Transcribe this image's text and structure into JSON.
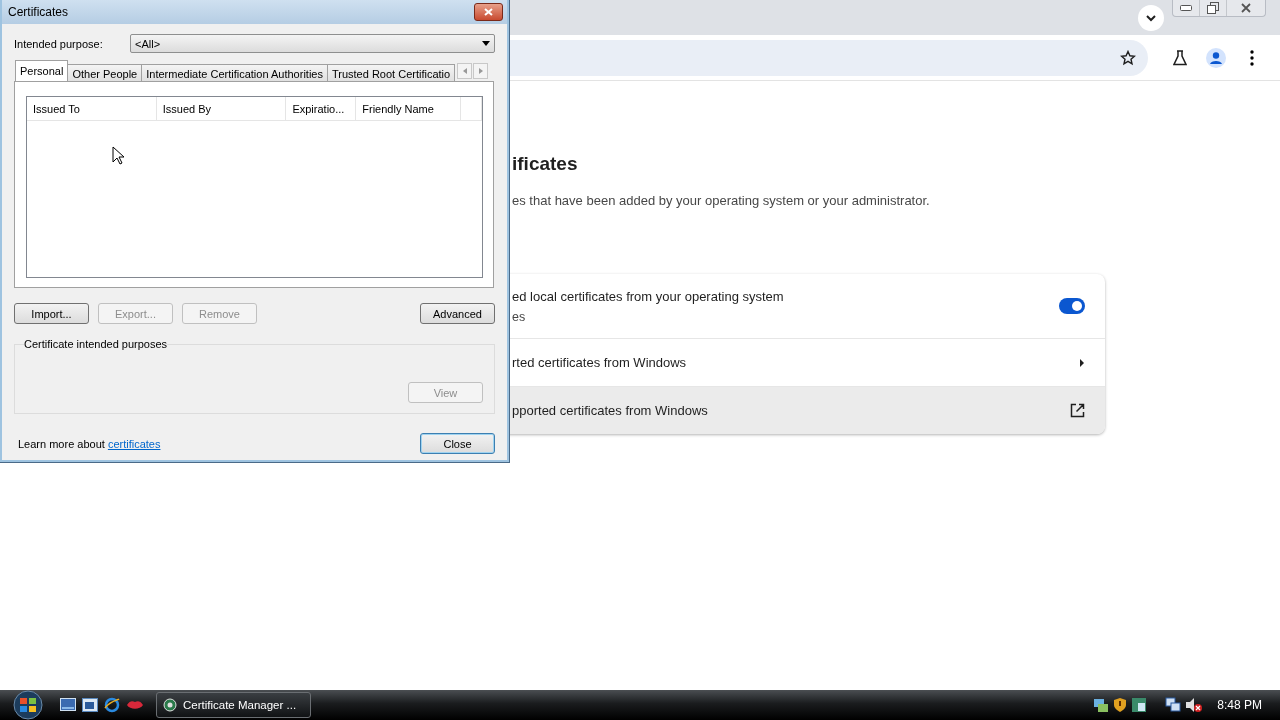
{
  "dialog": {
    "title": "Certificates",
    "purpose_label": "Intended purpose:",
    "purpose_value": "<All>",
    "tabs": [
      {
        "label": "Personal",
        "selected": true
      },
      {
        "label": "Other People",
        "selected": false
      },
      {
        "label": "Intermediate Certification Authorities",
        "selected": false
      },
      {
        "label": "Trusted Root Certificatio",
        "selected": false
      }
    ],
    "columns": [
      "Issued To",
      "Issued By",
      "Expiratio...",
      "Friendly Name"
    ],
    "buttons": [
      {
        "label": "Import...",
        "disabled": false
      },
      {
        "label": "Export...",
        "disabled": true
      },
      {
        "label": "Remove",
        "disabled": true
      }
    ],
    "advanced_button": "Advanced",
    "purposes_label": "Certificate intended purposes",
    "view_button": {
      "label": "View",
      "disabled": true
    },
    "learn_more": "Learn more about",
    "link": "certificates",
    "close_button": "Close"
  },
  "browser": {
    "heading": "ificates",
    "description": "es that have been added by your operating system or your administrator.",
    "settings": [
      {
        "kind": "toggle",
        "title": "ed local certificates from your operating system",
        "subtitle": "es",
        "on": true,
        "highlighted": false
      },
      {
        "kind": "submenu",
        "title": "rted certificates from Windows",
        "highlighted": false
      },
      {
        "kind": "external",
        "title": "pported certificates from Windows",
        "highlighted": true
      }
    ]
  },
  "taskbar": {
    "window_button": "Certificate Manager ...",
    "clock": "8:48 PM"
  }
}
